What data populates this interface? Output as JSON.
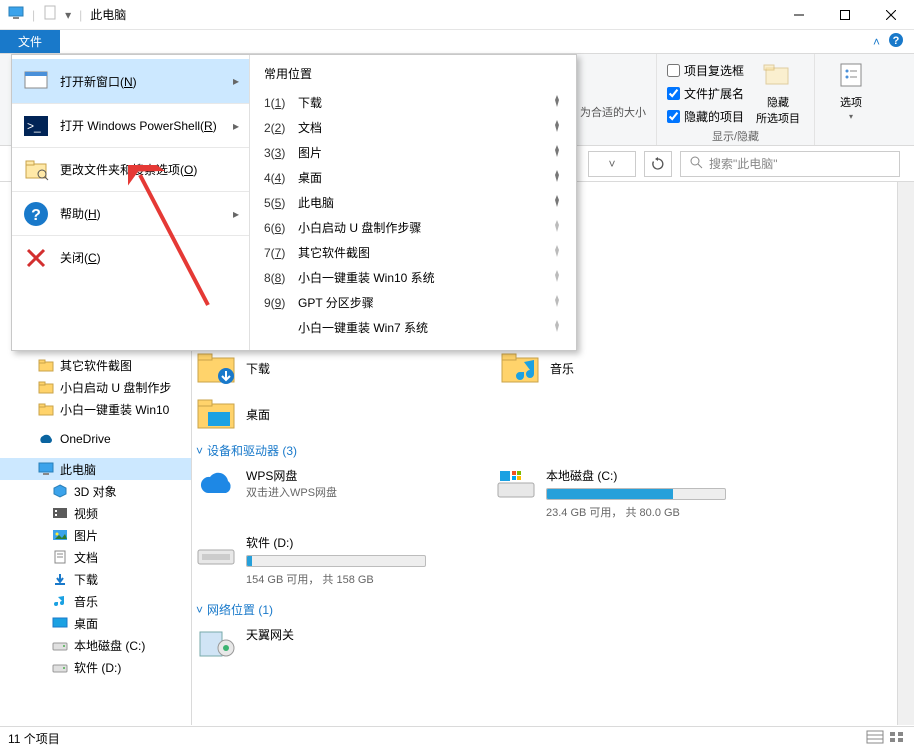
{
  "title": "此电脑",
  "file_tab": "文件",
  "ribbon": {
    "zoom_text": "为合适的大小",
    "chk_checkboxes": "项目复选框",
    "chk_extensions": "文件扩展名",
    "chk_hidden": "隐藏的项目",
    "hide_selected": "隐藏\n所选项目",
    "options": "选项",
    "group_label": "显示/隐藏"
  },
  "search_placeholder": "搜索\"此电脑\"",
  "file_menu": {
    "items": [
      {
        "label": "打开新窗口(N)",
        "has_sub": true
      },
      {
        "label": "打开 Windows PowerShell(R)",
        "has_sub": true
      },
      {
        "label": "更改文件夹和搜索选项(O)"
      },
      {
        "label": "帮助(H)",
        "has_sub": true
      },
      {
        "label": "关闭(C)"
      }
    ],
    "common_header": "常用位置",
    "locations": [
      {
        "num": "1(1)",
        "name": "下载",
        "pin": true
      },
      {
        "num": "2(2)",
        "name": "文档",
        "pin": true
      },
      {
        "num": "3(3)",
        "name": "图片",
        "pin": true
      },
      {
        "num": "4(4)",
        "name": "桌面",
        "pin": true
      },
      {
        "num": "5(5)",
        "name": "此电脑",
        "pin": true
      },
      {
        "num": "6(6)",
        "name": "小白启动 U 盘制作步骤"
      },
      {
        "num": "7(7)",
        "name": "其它软件截图"
      },
      {
        "num": "8(8)",
        "name": "小白一键重装 Win10 系统"
      },
      {
        "num": "9(9)",
        "name": "GPT 分区步骤"
      },
      {
        "num": "",
        "name": "小白一键重装 Win7 系统"
      }
    ]
  },
  "sidebar": [
    {
      "label": "其它软件截图",
      "type": "folder"
    },
    {
      "label": "小白启动 U 盘制作步",
      "type": "folder"
    },
    {
      "label": "小白一键重装 Win10",
      "type": "folder"
    },
    {
      "label": "OneDrive",
      "type": "onedrive",
      "gap": true
    },
    {
      "label": "此电脑",
      "type": "pc",
      "selected": true,
      "gap": true
    },
    {
      "label": "3D 对象",
      "type": "3d",
      "lvl": 2
    },
    {
      "label": "视频",
      "type": "video",
      "lvl": 2
    },
    {
      "label": "图片",
      "type": "pic",
      "lvl": 2
    },
    {
      "label": "文档",
      "type": "doc",
      "lvl": 2
    },
    {
      "label": "下载",
      "type": "dl",
      "lvl": 2
    },
    {
      "label": "音乐",
      "type": "music",
      "lvl": 2
    },
    {
      "label": "桌面",
      "type": "desk",
      "lvl": 2
    },
    {
      "label": "本地磁盘 (C:)",
      "type": "drive",
      "lvl": 2
    },
    {
      "label": "软件 (D:)",
      "type": "drive",
      "lvl": 2
    }
  ],
  "content": {
    "folders": [
      {
        "name": "下载",
        "icon": "dl"
      },
      {
        "name": "音乐",
        "icon": "music"
      },
      {
        "name": "桌面",
        "icon": "desk"
      }
    ],
    "devices_header": "设备和驱动器 (3)",
    "network_header": "网络位置 (1)",
    "wps": {
      "name": "WPS网盘",
      "sub": "双击进入WPS网盘"
    },
    "c_drive": {
      "name": "本地磁盘 (C:)",
      "free": "23.4 GB 可用， 共 80.0 GB",
      "pct": 71
    },
    "d_drive": {
      "name": "软件 (D:)",
      "free": "154 GB 可用， 共 158 GB",
      "pct": 3
    },
    "network_item": "天翼网关"
  },
  "status": "11 个项目"
}
